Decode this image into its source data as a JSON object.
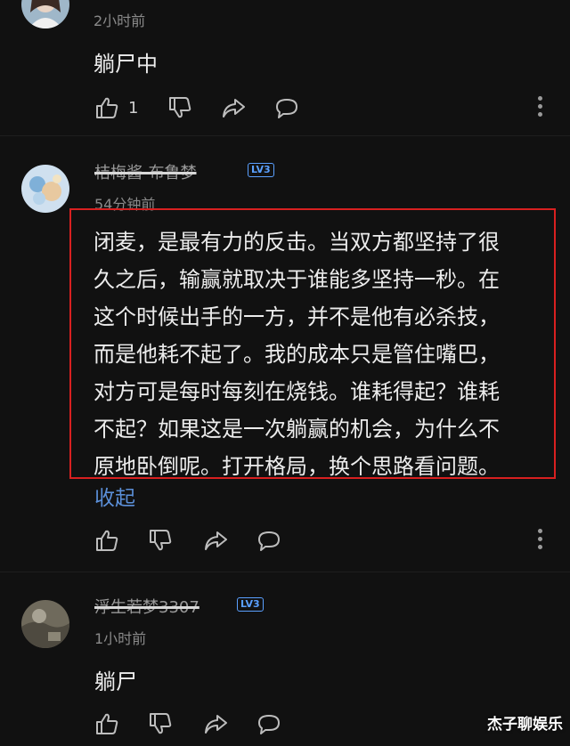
{
  "comments": [
    {
      "username": "",
      "level": "",
      "time": "2小时前",
      "text": "躺尸中",
      "like_count": "1"
    },
    {
      "username": "桔梅酱-布鲁梦",
      "level": "LV3",
      "time": "54分钟前",
      "lines": [
        "闭麦，是最有力的反击。当双方都坚持了很",
        "久之后，输赢就取决于谁能多坚持一秒。在",
        "这个时候出手的一方，并不是他有必杀技，",
        "而是他耗不起了。我的成本只是管住嘴巴，",
        "对方可是每时每刻在烧钱。谁耗得起？谁耗",
        "不起？如果这是一次躺赢的机会，为什么不",
        "原地卧倒呢。打开格局，换个思路看问题。"
      ],
      "collapse_label": "收起",
      "like_count": ""
    },
    {
      "username": "浮生若梦3307",
      "level": "LV3",
      "time": "1小时前",
      "text": "躺尸",
      "like_count": ""
    }
  ],
  "watermark": "杰子聊娱乐",
  "colors": {
    "background": "#111111",
    "highlight": "#d82020",
    "link": "#5b8fd8",
    "level": "#5aa0ff"
  },
  "icons": [
    "thumbs-up-icon",
    "thumbs-down-icon",
    "share-icon",
    "reply-icon",
    "more-icon"
  ]
}
